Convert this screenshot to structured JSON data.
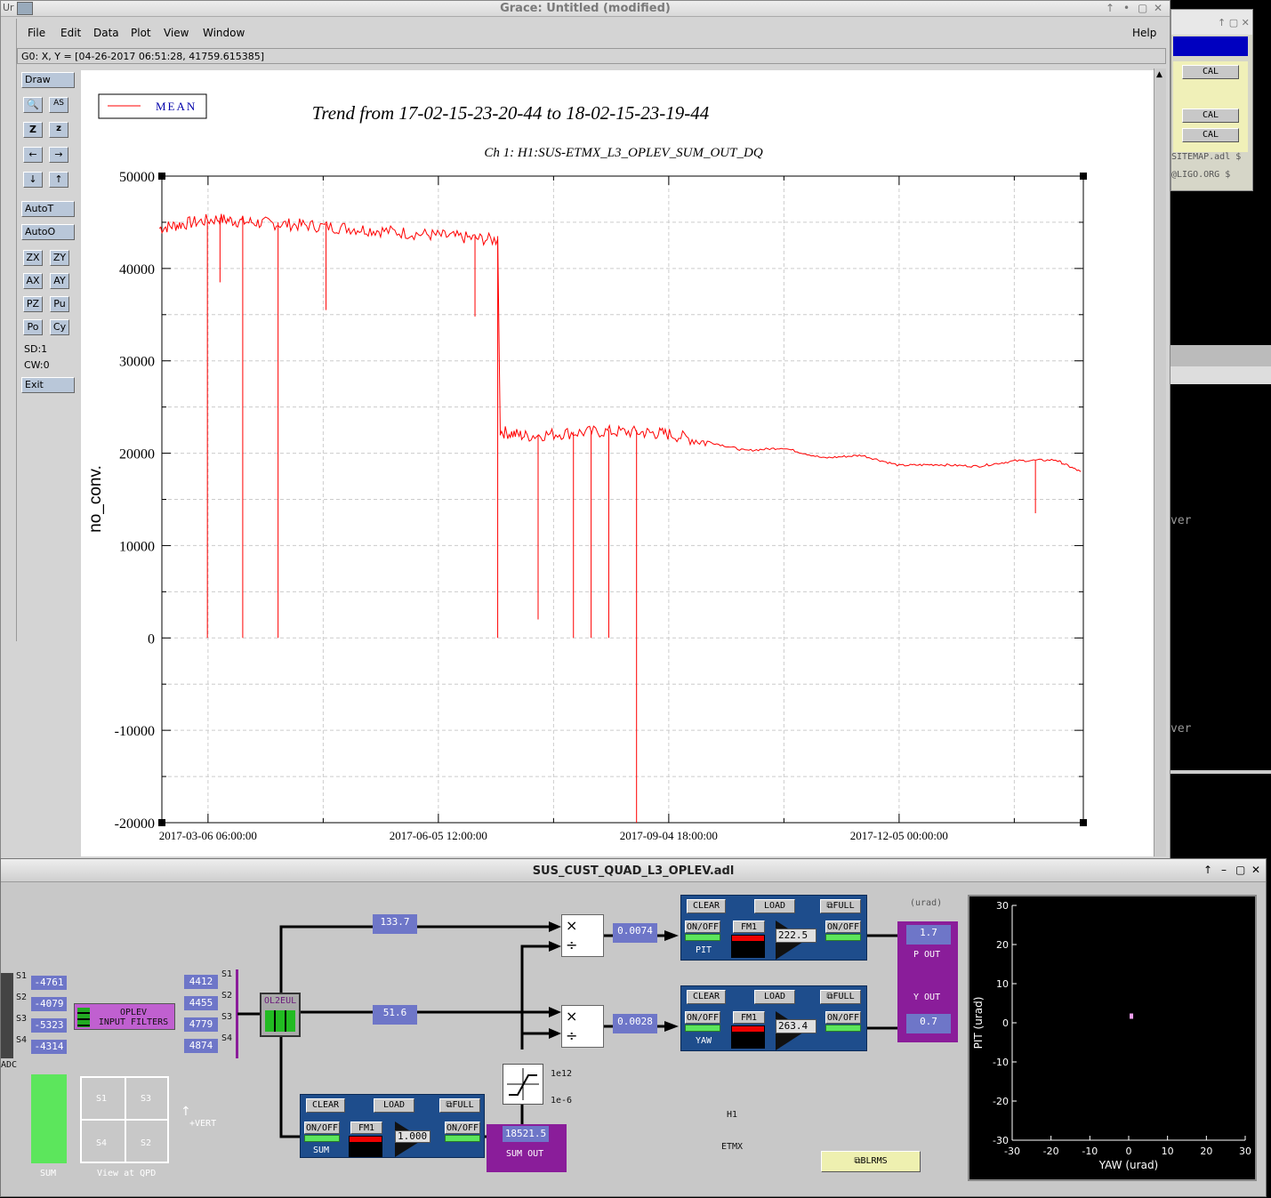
{
  "grace": {
    "window_title": "Grace: Untitled (modified)",
    "corner_label": "Ur",
    "menu": [
      "File",
      "Edit",
      "Data",
      "Plot",
      "View",
      "Window"
    ],
    "help": "Help",
    "locator": "G0: X, Y = [04-26-2017 06:51:28, 41759.615385]",
    "tools": {
      "draw": "Draw",
      "autot": "AutoT",
      "autoo": "AutoO",
      "zx": "ZX",
      "zy": "ZY",
      "ax": "AX",
      "ay": "AY",
      "pz": "PZ",
      "pu": "Pu",
      "po": "Po",
      "cy": "Cy",
      "sd": "SD:1",
      "cw": "CW:0",
      "exit": "Exit"
    },
    "legend": "MEAN",
    "plot_title": "Trend from 17-02-15-23-20-44 to 18-02-15-23-19-44",
    "plot_subtitle": "Ch 1: H1:SUS-ETMX_L3_OPLEV_SUM_OUT_DQ"
  },
  "chart_data": {
    "type": "line",
    "title": "Trend from 17-02-15-23-20-44 to 18-02-15-23-19-44",
    "subtitle": "Ch 1: H1:SUS-ETMX_L3_OPLEV_SUM_OUT_DQ",
    "xlabel": "",
    "ylabel": "no_conv.",
    "ylim": [
      -20000,
      50000
    ],
    "yticks": [
      -20000,
      -10000,
      0,
      10000,
      20000,
      30000,
      40000,
      50000
    ],
    "xticks": [
      "2017-03-06 06:00:00",
      "2017-06-05 12:00:00",
      "2017-09-04 18:00:00",
      "2017-12-05 00:00:00"
    ],
    "xlim": [
      "2017-02-15 23:20:44",
      "2018-02-15 23:19:44"
    ],
    "grid": true,
    "legend_position": "top-left",
    "series": [
      {
        "name": "MEAN",
        "color": "#ff0000",
        "x": [
          "2017-02-15",
          "2017-02-25",
          "2017-03-10",
          "2017-03-20",
          "2017-04-01",
          "2017-04-15",
          "2017-05-01",
          "2017-05-15",
          "2017-06-01",
          "2017-06-15",
          "2017-06-29",
          "2017-06-30",
          "2017-07-10",
          "2017-07-25",
          "2017-08-10",
          "2017-08-25",
          "2017-09-05",
          "2017-09-20",
          "2017-10-05",
          "2017-10-20",
          "2017-11-05",
          "2017-11-20",
          "2017-12-05",
          "2017-12-20",
          "2018-01-05",
          "2018-01-20",
          "2018-02-05",
          "2018-02-15"
        ],
        "y": [
          44500,
          45000,
          45500,
          45200,
          45000,
          44800,
          44500,
          44200,
          43800,
          43500,
          43200,
          22500,
          22000,
          22300,
          22500,
          22400,
          22200,
          21300,
          20300,
          20600,
          19500,
          19800,
          18700,
          18800,
          18600,
          19200,
          19300,
          18000
        ]
      }
    ],
    "dropouts": [
      {
        "x": "2017-03-06",
        "y": 0
      },
      {
        "x": "2017-03-20",
        "y": 0
      },
      {
        "x": "2017-04-03",
        "y": 0
      },
      {
        "x": "2017-06-29",
        "y": 0
      },
      {
        "x": "2017-07-15",
        "y": 2000
      },
      {
        "x": "2017-07-29",
        "y": 0
      },
      {
        "x": "2017-08-05",
        "y": 0
      },
      {
        "x": "2017-08-12",
        "y": 0
      },
      {
        "x": "2017-08-23",
        "y": -20000
      },
      {
        "x": "2017-03-11",
        "y": 38500
      },
      {
        "x": "2017-04-22",
        "y": 35500
      },
      {
        "x": "2017-06-20",
        "y": 34800
      },
      {
        "x": "2018-01-28",
        "y": 13500
      }
    ]
  },
  "right_panel": {
    "items": [
      "CAL",
      "CAL",
      "CAL"
    ],
    "text1": "SITEMAP.adl $",
    "text2": "@LIGO.ORG $",
    "text3": "ver",
    "text4": "ver"
  },
  "medm": {
    "window_title": "SUS_CUST_QUAD_L3_OPLEV.adl",
    "adc": {
      "labels": [
        "S1",
        "S2",
        "S3",
        "S4"
      ],
      "values": [
        "-4761",
        "-4079",
        "-5323",
        "-4314"
      ],
      "name": "ADC"
    },
    "input_filters": "OPLEV\nINPUT FILTERS",
    "segments": {
      "labels": [
        "S1",
        "S2",
        "S3",
        "S4"
      ],
      "values": [
        "4412",
        "4455",
        "4779",
        "4874"
      ]
    },
    "ol2eul": "OL2EUL",
    "pit_in": "133.7",
    "yaw_in": "51.6",
    "pit_norm": "0.0074",
    "yaw_norm": "0.0028",
    "clear": "CLEAR",
    "load": "LOAD",
    "full": "FULL",
    "onoff": "ON/OFF",
    "fm1": "FM1",
    "pit_gain": "222.5",
    "yaw_gain": "263.4",
    "sum_gain": "1.000",
    "pit_label": "PIT",
    "yaw_label": "YAW",
    "sum_label": "SUM",
    "urad": "(urad)",
    "p_out_val": "1.7",
    "p_out": "P OUT",
    "y_out": "Y OUT",
    "y_out_val": "0.7",
    "sum_out_val": "18521.5",
    "sum_out": "SUM OUT",
    "limit_hi": "1e12",
    "limit_lo": "1e-6",
    "qpd": {
      "cells": [
        "S1",
        "S3",
        "S4",
        "S2"
      ],
      "caption": "View at QPD",
      "vert": "+VERT",
      "sum": "SUM"
    },
    "site": "H1",
    "optic": "ETMX",
    "blrms": "BLRMS",
    "scatter": {
      "xlabel": "YAW (urad)",
      "ylabel": "PIT (urad)",
      "xticks": [
        "-30",
        "-20",
        "-10",
        "0",
        "10",
        "20",
        "30"
      ],
      "yticks": [
        "30",
        "20",
        "10",
        "0",
        "-10",
        "-20",
        "-30"
      ],
      "point": {
        "x": 0.7,
        "y": 1.7
      }
    }
  }
}
